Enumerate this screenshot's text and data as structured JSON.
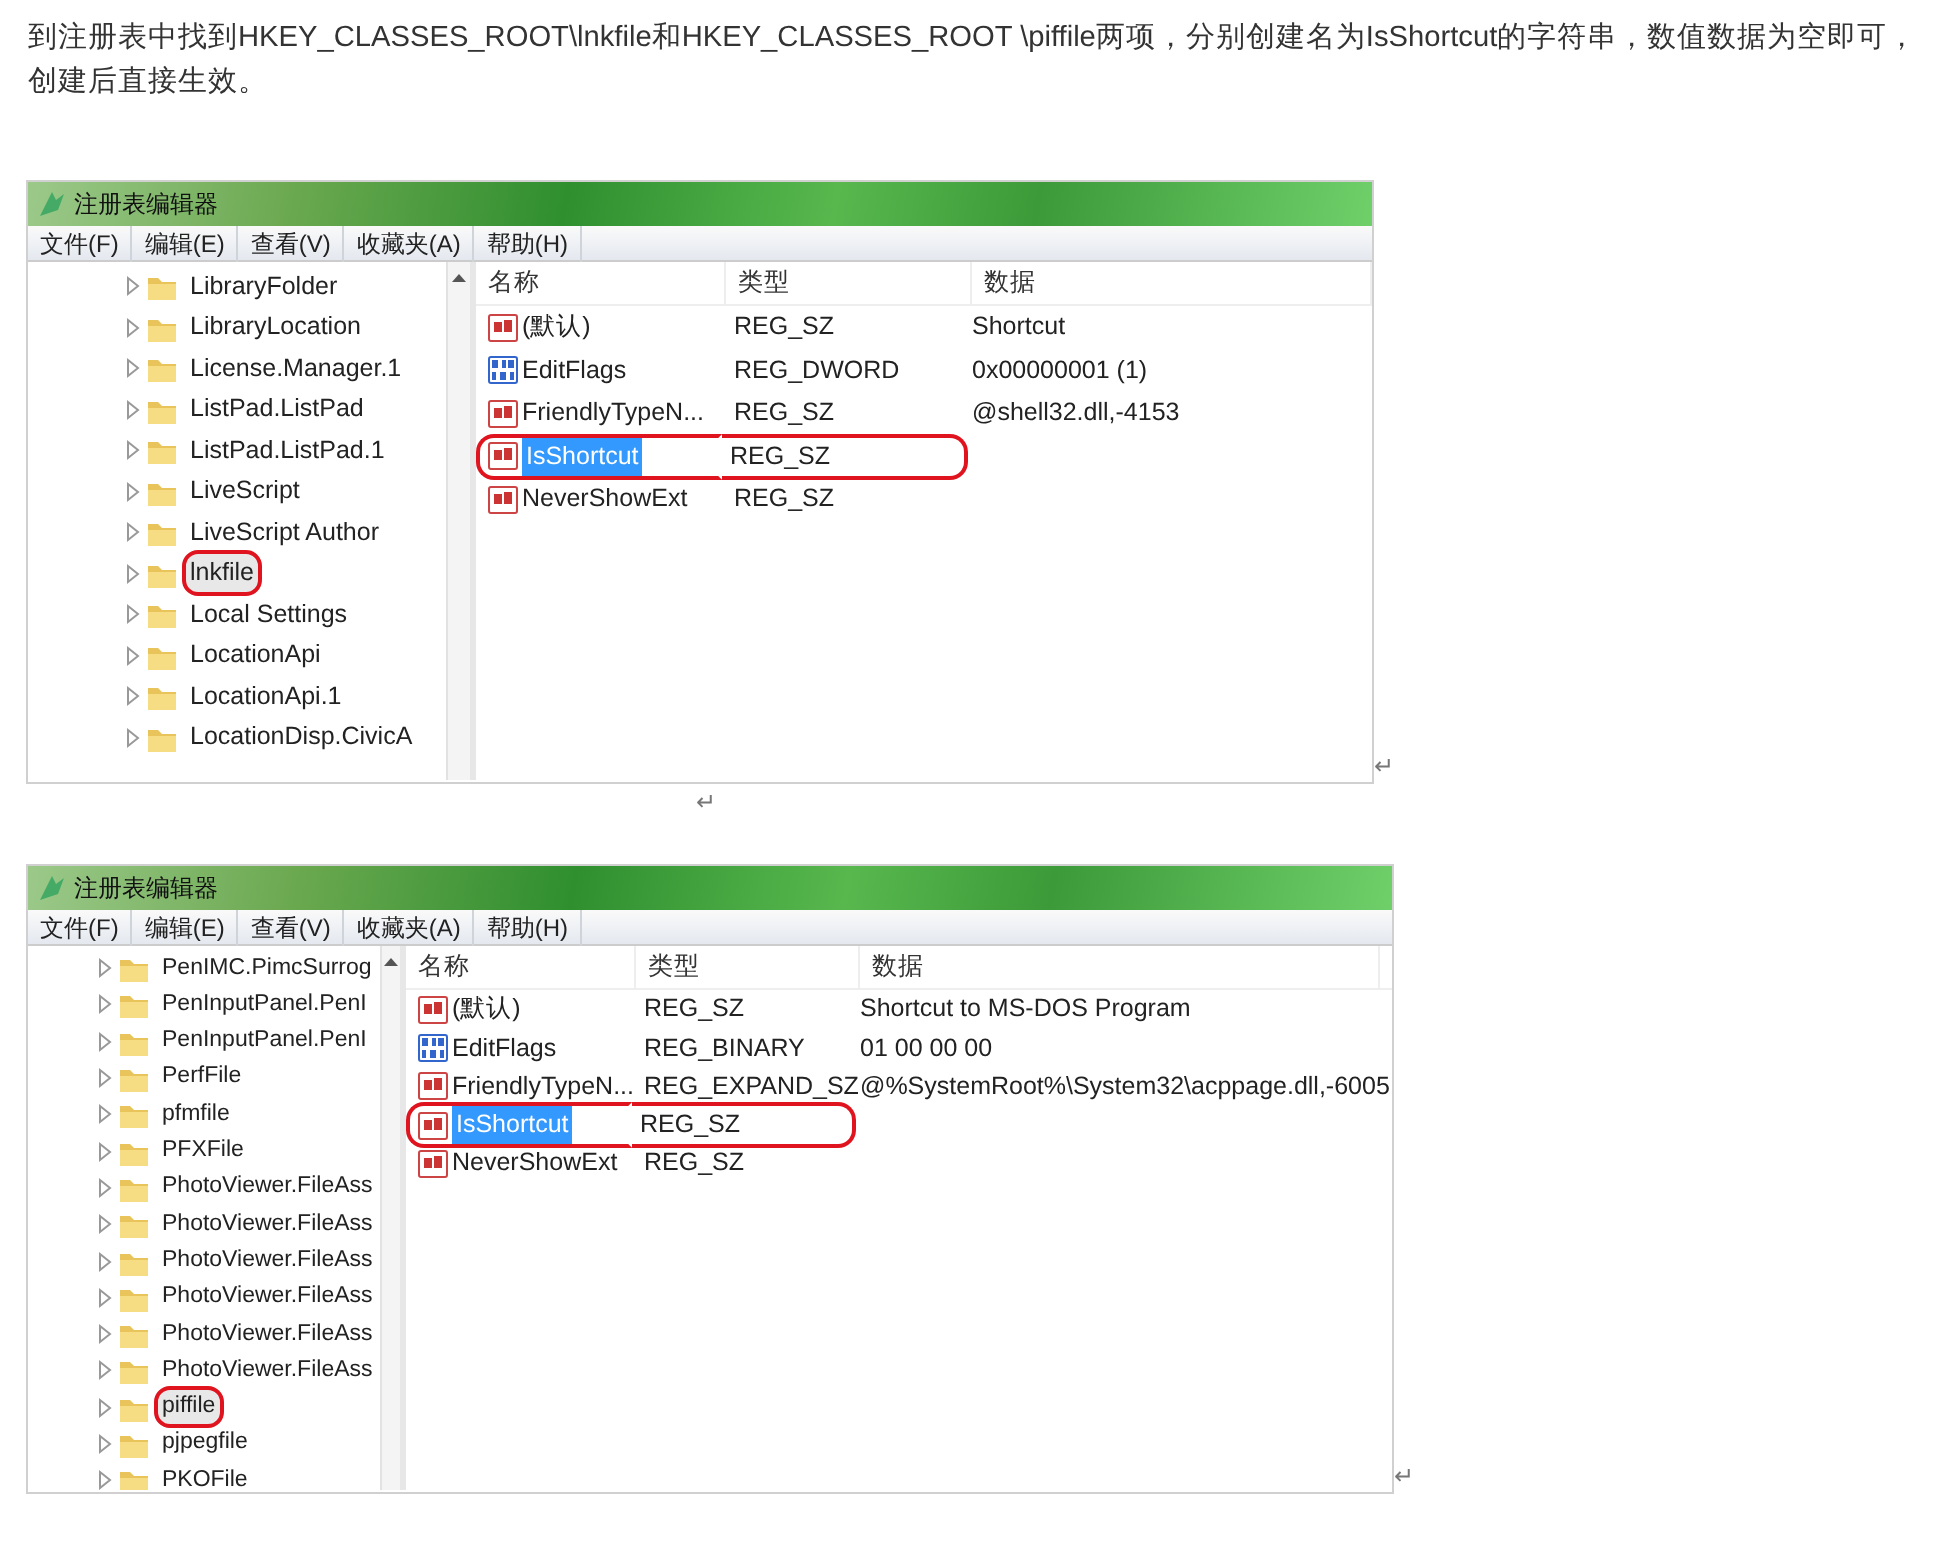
{
  "intro": "到注册表中找到HKEY_CLASSES_ROOT\\lnkfile和HKEY_CLASSES_ROOT \\piffile两项，分别创建名为IsShortcut的字符串，数值数据为空即可，创建后直接生效。",
  "windows": [
    {
      "title": "注册表编辑器",
      "menu": [
        "文件(F)",
        "编辑(E)",
        "查看(V)",
        "收藏夹(A)",
        "帮助(H)"
      ],
      "columns": [
        "名称",
        "类型",
        "数据"
      ],
      "tree": [
        {
          "label": "LibraryFolder",
          "selected": false,
          "circled": false
        },
        {
          "label": "LibraryLocation",
          "selected": false,
          "circled": false
        },
        {
          "label": "License.Manager.1",
          "selected": false,
          "circled": false
        },
        {
          "label": "ListPad.ListPad",
          "selected": false,
          "circled": false
        },
        {
          "label": "ListPad.ListPad.1",
          "selected": false,
          "circled": false
        },
        {
          "label": "LiveScript",
          "selected": false,
          "circled": false
        },
        {
          "label": "LiveScript Author",
          "selected": false,
          "circled": false
        },
        {
          "label": "lnkfile",
          "selected": true,
          "circled": true
        },
        {
          "label": "Local Settings",
          "selected": false,
          "circled": false
        },
        {
          "label": "LocationApi",
          "selected": false,
          "circled": false
        },
        {
          "label": "LocationApi.1",
          "selected": false,
          "circled": false
        },
        {
          "label": "LocationDisp.CivicA",
          "selected": false,
          "circled": false
        }
      ],
      "values": [
        {
          "kind": "string",
          "name": "(默认)",
          "type": "REG_SZ",
          "data": "Shortcut",
          "selected": false,
          "circled": false
        },
        {
          "kind": "binary",
          "name": "EditFlags",
          "type": "REG_DWORD",
          "data": "0x00000001 (1)",
          "selected": false,
          "circled": false
        },
        {
          "kind": "string",
          "name": "FriendlyTypeN...",
          "type": "REG_SZ",
          "data": "@shell32.dll,-4153",
          "selected": false,
          "circled": false
        },
        {
          "kind": "string",
          "name": "IsShortcut",
          "type": "REG_SZ",
          "selected": true,
          "circled": true
        },
        {
          "kind": "string",
          "name": "NeverShowExt",
          "type": "REG_SZ",
          "selected": false,
          "circled": false
        }
      ],
      "marks": [
        "↵",
        "↵"
      ]
    },
    {
      "title": "注册表编辑器",
      "menu": [
        "文件(F)",
        "编辑(E)",
        "查看(V)",
        "收藏夹(A)",
        "帮助(H)"
      ],
      "columns": [
        "名称",
        "类型",
        "数据"
      ],
      "tree": [
        {
          "label": "PenIMC.PimcSurrog",
          "selected": false,
          "circled": false
        },
        {
          "label": "PenInputPanel.PenI",
          "selected": false,
          "circled": false
        },
        {
          "label": "PenInputPanel.PenI",
          "selected": false,
          "circled": false
        },
        {
          "label": "PerfFile",
          "selected": false,
          "circled": false
        },
        {
          "label": "pfmfile",
          "selected": false,
          "circled": false
        },
        {
          "label": "PFXFile",
          "selected": false,
          "circled": false
        },
        {
          "label": "PhotoViewer.FileAss",
          "selected": false,
          "circled": false
        },
        {
          "label": "PhotoViewer.FileAss",
          "selected": false,
          "circled": false
        },
        {
          "label": "PhotoViewer.FileAss",
          "selected": false,
          "circled": false
        },
        {
          "label": "PhotoViewer.FileAss",
          "selected": false,
          "circled": false
        },
        {
          "label": "PhotoViewer.FileAss",
          "selected": false,
          "circled": false
        },
        {
          "label": "PhotoViewer.FileAss",
          "selected": false,
          "circled": false
        },
        {
          "label": "piffile",
          "selected": true,
          "circled": true
        },
        {
          "label": "pjpegfile",
          "selected": false,
          "circled": false
        },
        {
          "label": "PKOFile",
          "selected": false,
          "circled": false
        }
      ],
      "values": [
        {
          "kind": "string",
          "name": "(默认)",
          "type": "REG_SZ",
          "data": "Shortcut to MS-DOS Program",
          "selected": false,
          "circled": false
        },
        {
          "kind": "binary",
          "name": "EditFlags",
          "type": "REG_BINARY",
          "data": "01 00 00 00",
          "selected": false,
          "circled": false
        },
        {
          "kind": "string",
          "name": "FriendlyTypeN...",
          "type": "REG_EXPAND_SZ",
          "data": "@%SystemRoot%\\System32\\acppage.dll,-6005",
          "selected": false,
          "circled": false
        },
        {
          "kind": "string",
          "name": "IsShortcut",
          "type": "REG_SZ",
          "selected": true,
          "circled": true
        },
        {
          "kind": "string",
          "name": "NeverShowExt",
          "type": "REG_SZ",
          "selected": false,
          "circled": false
        }
      ],
      "marks": [
        "↵"
      ]
    }
  ]
}
